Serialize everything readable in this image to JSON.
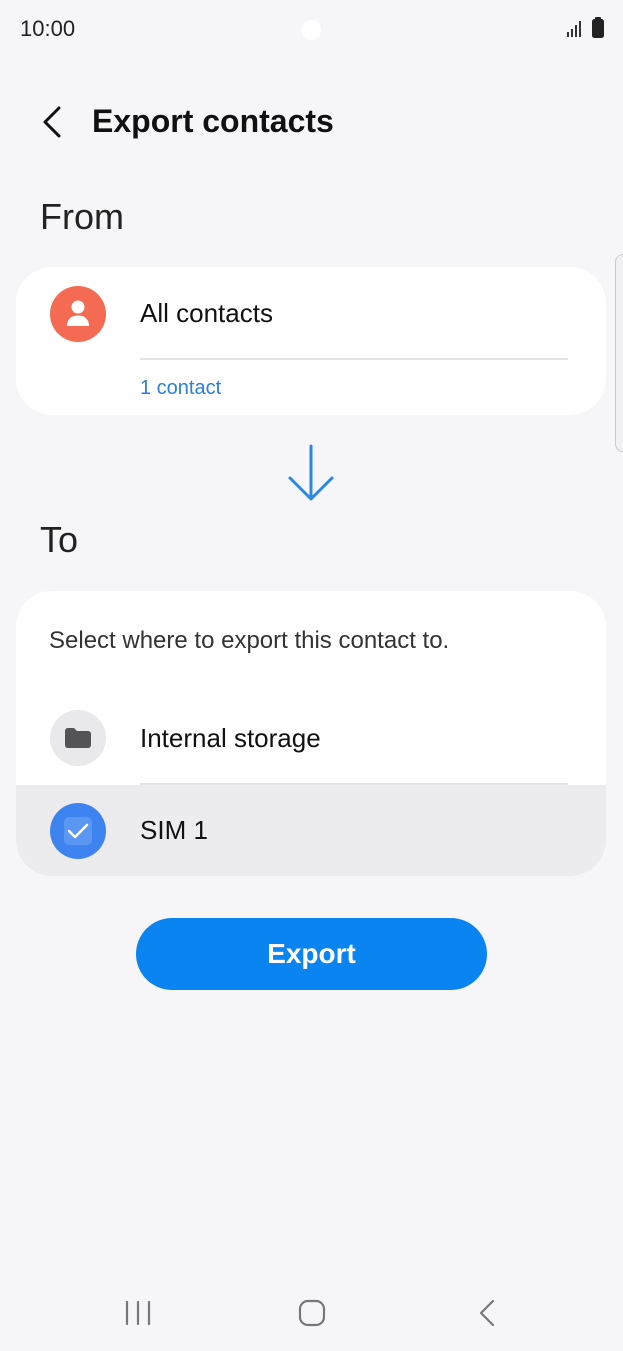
{
  "status_bar": {
    "time": "10:00"
  },
  "header": {
    "title": "Export contacts",
    "back_icon": "chevron-left-icon"
  },
  "from": {
    "section_label": "From",
    "source_title": "All contacts",
    "source_subtitle": "1 contact",
    "avatar_icon": "person-icon",
    "avatar_color": "#f46a52",
    "subtitle_color": "#2a7de1"
  },
  "to": {
    "section_label": "To",
    "instruction": "Select where to export this contact to.",
    "options": [
      {
        "label": "Internal storage",
        "icon": "folder-icon",
        "selected": false
      },
      {
        "label": "SIM 1",
        "icon": "sim-check-icon",
        "selected": true
      }
    ]
  },
  "actions": {
    "export_label": "Export",
    "accent_color": "#0a84f0"
  },
  "nav_bar": {
    "recents_icon": "recents-icon",
    "home_icon": "home-icon",
    "back_icon": "nav-back-icon"
  }
}
